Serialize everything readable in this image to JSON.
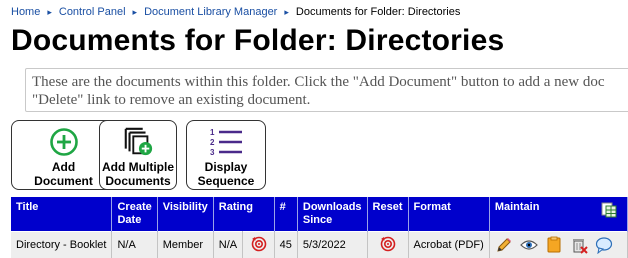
{
  "breadcrumb": {
    "items": [
      "Home",
      "Control Panel",
      "Document Library Manager"
    ],
    "current": "Documents for Folder: Directories"
  },
  "page": {
    "title": "Documents for Folder: Directories",
    "info": [
      "These are the documents within this folder. Click the \"Add Document\" button to add a new doc",
      "\"Delete\" link to remove an existing document."
    ]
  },
  "toolbar": {
    "add_document": [
      "Add",
      "Document"
    ],
    "add_multiple": [
      "Add Multiple",
      "Documents"
    ],
    "display_sequence": [
      "Display",
      "Sequence"
    ]
  },
  "table": {
    "headers": {
      "title": "Title",
      "create_date": [
        "Create",
        "Date"
      ],
      "visibility": "Visibility",
      "rating": "Rating",
      "number": "#",
      "downloads_since": [
        "Downloads",
        "Since"
      ],
      "reset": "Reset",
      "format": "Format",
      "maintain": "Maintain"
    },
    "rows": [
      {
        "title": "Directory - Booklet",
        "create_date": "N/A",
        "visibility": "Member",
        "rating": "N/A",
        "number": "45",
        "downloads_since": "5/3/2022",
        "format": "Acrobat (PDF)"
      }
    ]
  },
  "icons": [
    "add-circle-icon",
    "add-multiple-icon",
    "numbered-list-icon",
    "reset-target-icon",
    "export-spreadsheet-icon",
    "edit-pencil-icon",
    "view-eye-icon",
    "folder-icon",
    "delete-trash-icon",
    "comment-bubble-icon"
  ],
  "colors": {
    "link": "#1a4fa3",
    "header_bg": "#0000cc",
    "green": "#1fa644",
    "purple": "#4a2a8a",
    "red": "#d42020"
  }
}
